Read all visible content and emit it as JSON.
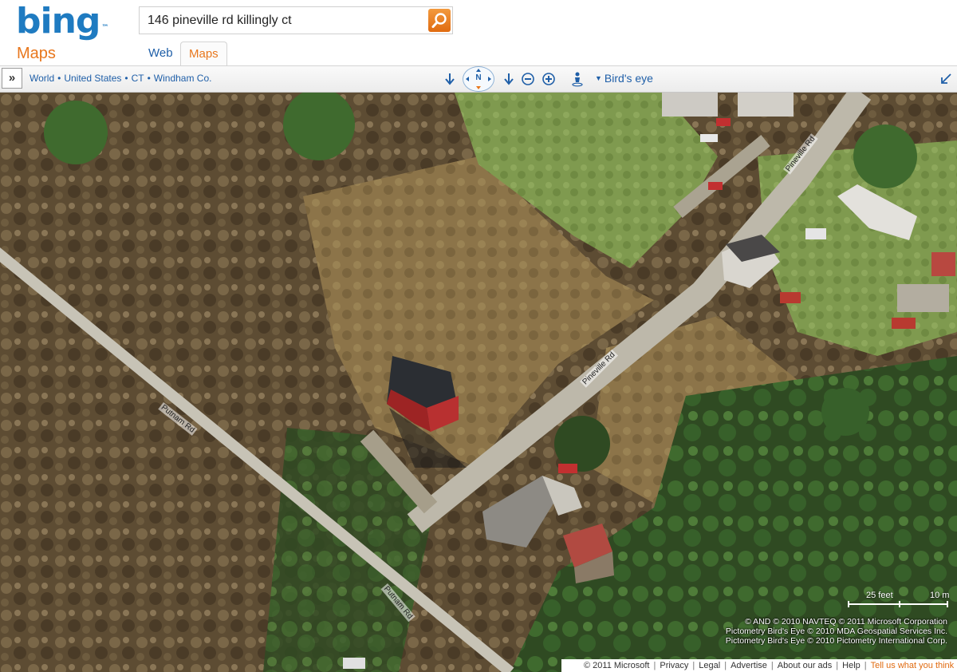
{
  "brand": {
    "logo": "bing",
    "logo_mark": "™",
    "product": "Maps"
  },
  "search": {
    "query": "146 pineville rd killingly ct",
    "button_icon": "search-icon"
  },
  "tabs": [
    {
      "label": "Web",
      "active": false
    },
    {
      "label": "Maps",
      "active": true
    }
  ],
  "toolbar": {
    "expand_label": "»",
    "breadcrumb": [
      "World",
      "United States",
      "CT",
      "Windham Co."
    ],
    "compass_label": "N",
    "view_mode": "Bird's eye"
  },
  "map": {
    "roads": [
      {
        "label": "Pineville Rd"
      },
      {
        "label": "Pineville Rd"
      },
      {
        "label": "Putnam Rd"
      },
      {
        "label": "Putnam Rd"
      }
    ],
    "scale": {
      "feet": "25 feet",
      "meters": "10 m"
    },
    "copyright": [
      "© AND  © 2010 NAVTEQ  © 2011 Microsoft Corporation",
      "Pictometry Bird's Eye © 2010 MDA Geospatial Services Inc.",
      "Pictometry Bird's Eye © 2010 Pictometry International Corp."
    ]
  },
  "footer": {
    "copyright": "© 2011 Microsoft",
    "links": [
      "Privacy",
      "Legal",
      "Advertise",
      "About our ads",
      "Help"
    ],
    "feedback": "Tell us what you think"
  },
  "colors": {
    "brand_blue": "#1f7bc1",
    "brand_orange": "#e8771d",
    "link_blue": "#1f5fa8"
  }
}
